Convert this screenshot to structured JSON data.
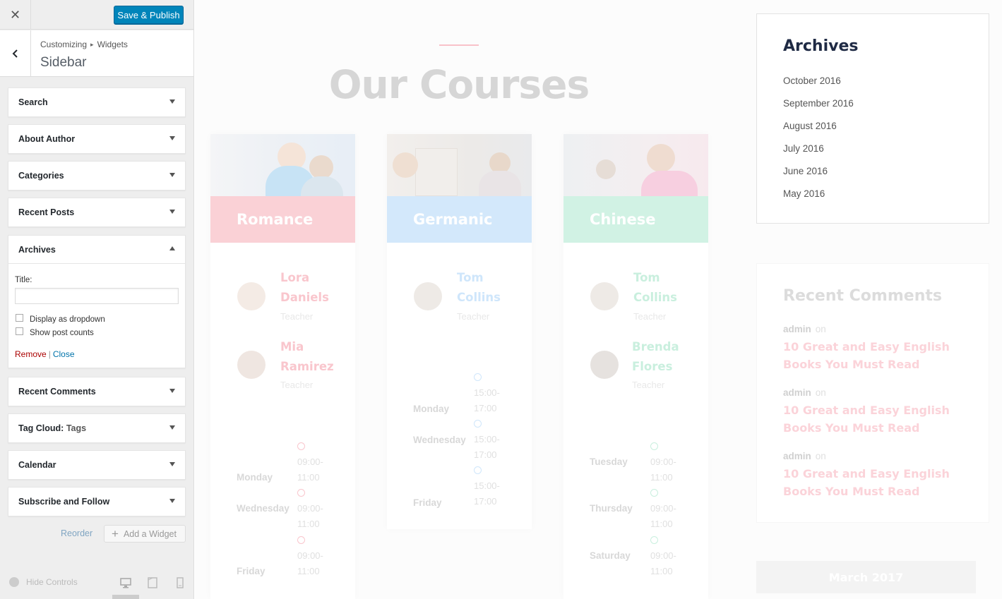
{
  "header": {
    "close_icon": "close-icon",
    "save_label": "Save & Publish",
    "accent_color": "#0085ba"
  },
  "section": {
    "breadcrumb_root": "Customizing",
    "breadcrumb_child": "Widgets",
    "title": "Sidebar"
  },
  "widgets": [
    {
      "label": "Search",
      "expanded": false
    },
    {
      "label": "About Author",
      "expanded": false
    },
    {
      "label": "Categories",
      "expanded": false
    },
    {
      "label": "Recent Posts",
      "expanded": false
    },
    {
      "label": "Archives",
      "expanded": true
    },
    {
      "label": "Recent Comments",
      "expanded": false
    },
    {
      "label": "Tag Cloud:",
      "suffix": "Tags",
      "expanded": false
    },
    {
      "label": "Calendar",
      "expanded": false
    },
    {
      "label": "Subscribe and Follow",
      "expanded": false
    }
  ],
  "archives_form": {
    "title_label": "Title:",
    "title_value": "",
    "dropdown_label": "Display as dropdown",
    "dropdown_checked": false,
    "counts_label": "Show post counts",
    "counts_checked": false,
    "remove_label": "Remove",
    "close_label": "Close"
  },
  "sidebar_actions": {
    "reorder_label": "Reorder",
    "add_widget_label": "Add a Widget"
  },
  "footer": {
    "hide_controls_label": "Hide Controls",
    "devices": [
      "desktop-icon",
      "tablet-icon",
      "mobile-icon"
    ],
    "active_device": "desktop"
  },
  "preview": {
    "courses_title": "Our Courses",
    "courses": [
      {
        "name": "Romance",
        "color": "#f9c5cc",
        "teachers": [
          {
            "first": "Lora",
            "last": "Daniels",
            "role": "Teacher"
          },
          {
            "first": "Mia",
            "last": "Ramirez",
            "role": "Teacher"
          }
        ],
        "schedule": [
          {
            "day": "Monday",
            "time": "09:00-11:00"
          },
          {
            "day": "Wednesday",
            "time": "09:00-11:00"
          },
          {
            "day": "Friday",
            "time": "09:00-11:00"
          }
        ]
      },
      {
        "name": "Germanic",
        "color": "#cde6fb",
        "teachers": [
          {
            "first": "Tom",
            "last": "Collins",
            "role": "Teacher"
          }
        ],
        "schedule": [
          {
            "day": "Monday",
            "time": "15:00-17:00"
          },
          {
            "day": "Wednesday",
            "time": "15:00-17:00"
          },
          {
            "day": "Friday",
            "time": "15:00-17:00"
          }
        ]
      },
      {
        "name": "Chinese",
        "color": "#c9f0df",
        "teachers": [
          {
            "first": "Tom",
            "last": "Collins",
            "role": "Teacher"
          },
          {
            "first": "Brenda",
            "last": "Flores",
            "role": "Teacher"
          }
        ],
        "schedule": [
          {
            "day": "Tuesday",
            "time": "09:00-11:00"
          },
          {
            "day": "Thursday",
            "time": "09:00-11:00"
          },
          {
            "day": "Saturday",
            "time": "09:00-11:00"
          }
        ]
      }
    ],
    "archives": {
      "heading": "Archives",
      "items": [
        "October 2016",
        "September 2016",
        "August 2016",
        "July 2016",
        "June 2016",
        "May 2016"
      ]
    },
    "recent_comments": {
      "heading": "Recent Comments",
      "items": [
        {
          "author": "admin",
          "on": "on",
          "post": "10 Great and Easy English Books You Must Read"
        },
        {
          "author": "admin",
          "on": "on",
          "post": "10 Great and Easy English Books You Must Read"
        },
        {
          "author": "admin",
          "on": "on",
          "post": "10 Great and Easy English Books You Must Read"
        }
      ]
    },
    "calendar_caption": "March 2017"
  }
}
